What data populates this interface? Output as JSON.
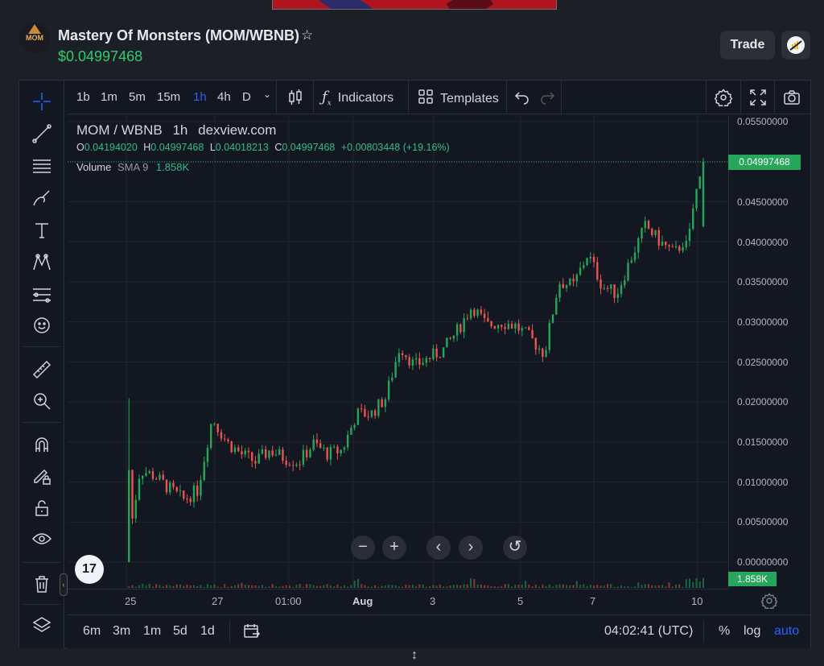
{
  "header": {
    "logo_text": "MOM",
    "pair_title": "Mastery Of Monsters (MOM/WBNB)",
    "price": "$0.04997468",
    "trade_label": "Trade"
  },
  "toolbar": {
    "timeframes": [
      "1b",
      "1m",
      "5m",
      "15m",
      "1h",
      "4h",
      "D"
    ],
    "active_timeframe": "1h",
    "indicators_label": "Indicators",
    "templates_label": "Templates"
  },
  "legend": {
    "symbol": "MOM / WBNB",
    "interval": "1h",
    "source": "dexview.com",
    "o_label": "O",
    "o_value": "0.04194020",
    "h_label": "H",
    "h_value": "0.04997468",
    "l_label": "L",
    "l_value": "0.04018213",
    "c_label": "C",
    "c_value": "0.04997468",
    "change": "+0.00803448 (+19.16%)",
    "volume_label": "Volume",
    "volume_sma": "SMA 9",
    "volume_value": "1.858K"
  },
  "price_axis": {
    "labels": [
      "0.05500000",
      "0.04500000",
      "0.04000000",
      "0.03500000",
      "0.03000000",
      "0.02500000",
      "0.02000000",
      "0.01500000",
      "0.01000000",
      "0.00500000",
      "0.00000000"
    ],
    "current_price": "0.04997468",
    "volume_tag": "1.858K"
  },
  "time_axis": {
    "labels": [
      "25",
      "27",
      "01:00",
      "Aug",
      "3",
      "5",
      "7",
      "10"
    ]
  },
  "bottom_bar": {
    "ranges": [
      "6m",
      "3m",
      "1m",
      "5d",
      "1d"
    ],
    "clock": "04:02:41 (UTC)",
    "percent_label": "%",
    "log_label": "log",
    "auto_label": "auto"
  },
  "colors": {
    "up": "#26a65a",
    "down": "#ef5350",
    "accent": "#2962ff",
    "price_green": "#2ecc71"
  },
  "chart_data": {
    "type": "candlestick",
    "ylim": [
      0,
      0.055
    ],
    "x": [
      "25",
      "27",
      "01:00",
      "Aug",
      "3",
      "5",
      "7",
      "10"
    ],
    "close": [
      0.0,
      0.0115,
      0.0108,
      0.0092,
      0.0078,
      0.009,
      0.018,
      0.015,
      0.0135,
      0.0125,
      0.014,
      0.013,
      0.0125,
      0.0148,
      0.0135,
      0.014,
      0.0185,
      0.0185,
      0.0205,
      0.027,
      0.0245,
      0.0255,
      0.0265,
      0.029,
      0.032,
      0.0295,
      0.03,
      0.0295,
      0.028,
      0.026,
      0.035,
      0.0345,
      0.0385,
      0.0345,
      0.0335,
      0.038,
      0.042,
      0.04,
      0.0385,
      0.041,
      0.04997468
    ],
    "volume_last": "1.858K"
  }
}
